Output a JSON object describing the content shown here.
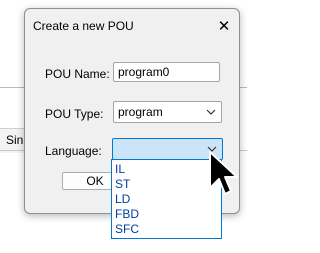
{
  "background": {
    "partial_text": "Sin"
  },
  "dialog": {
    "title": "Create a new POU",
    "close_glyph": "✕",
    "pou_name_label": "POU Name:",
    "pou_name_value": "program0",
    "pou_type_label": "POU Type:",
    "pou_type_value": "program",
    "language_label": "Language:",
    "language_value": "",
    "ok_label": "OK"
  },
  "language_dropdown": {
    "options": [
      "IL",
      "ST",
      "LD",
      "FBD",
      "SFC"
    ]
  },
  "colors": {
    "dialog_bg": "#f0f0f0",
    "accent": "#0078d4",
    "selected_field_bg": "#cce4f7",
    "option_text": "#003fa0"
  },
  "icons": {
    "close": "close-icon",
    "chevron": "chevron-down-icon",
    "cursor": "mouse-pointer-icon"
  }
}
